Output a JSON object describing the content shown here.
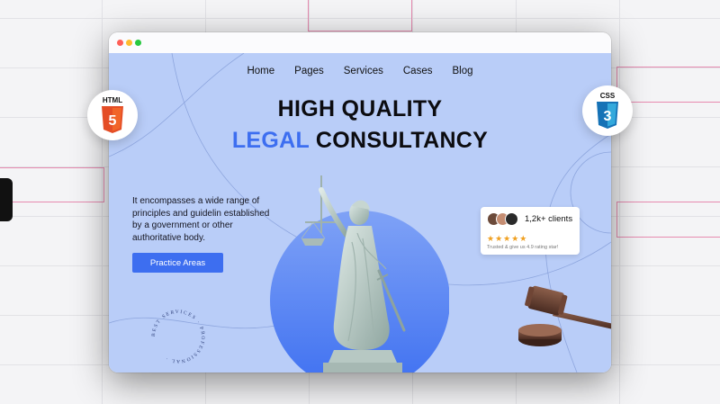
{
  "nav": {
    "items": [
      "Home",
      "Pages",
      "Services",
      "Cases",
      "Blog"
    ]
  },
  "hero": {
    "headline_line1": "HIGH QUALITY",
    "headline_accent": "LEGAL",
    "headline_rest": " CONSULTANCY",
    "description": "It encompasses a wide range of principles and guidelin established by a government or other authoritative body.",
    "cta_label": "Practice Areas",
    "stamp_text": "BEST SERVICES · PROFESSIONAL ·"
  },
  "clients_card": {
    "count": "1,2k+ clients",
    "stars": "★★★★★",
    "rating_text": "Trusted & give us 4.9 rating star!"
  },
  "badges": {
    "html_label": "HTML",
    "html_number": "5",
    "css_label": "CSS",
    "css_number": "3"
  },
  "colors": {
    "accent": "#3d6ef0",
    "site_bg": "#b9cdf8",
    "html_orange": "#e44d26",
    "css_blue": "#2965f1"
  },
  "icons": [
    "html5-icon",
    "css3-icon",
    "statue-of-justice-image",
    "gavel-image",
    "close-dot",
    "minimize-dot",
    "maximize-dot"
  ]
}
